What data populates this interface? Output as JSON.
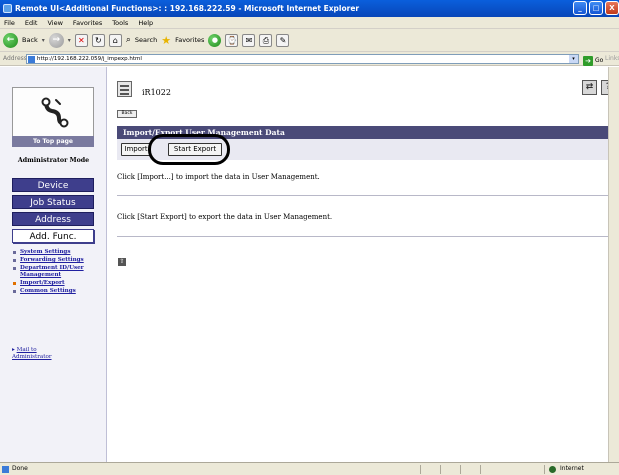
{
  "window": {
    "title": "Remote UI<Additional Functions>: : 192.168.222.59 - Microsoft Internet Explorer",
    "controls": [
      "_",
      "□",
      "X"
    ]
  },
  "menubar": [
    "File",
    "Edit",
    "View",
    "Favorites",
    "Tools",
    "Help"
  ],
  "toolbar": {
    "back_label": "Back",
    "search_label": "Search",
    "favorites_label": "Favorites"
  },
  "address": {
    "label": "Address",
    "url": "http://192.168.222.059/j_impexp.html",
    "go_label": "Go",
    "links_label": "Links"
  },
  "sidebar": {
    "to_top_label": "To Top page",
    "admin_mode_label": "Administrator Mode",
    "nav_buttons": [
      "Device",
      "Job Status",
      "Address",
      "Add. Func."
    ],
    "active_nav": "Add. Func.",
    "sublinks": [
      {
        "label": "System Settings"
      },
      {
        "label": "Forwarding Settings"
      },
      {
        "label": "Department ID/User Management"
      },
      {
        "label": "Import/Export"
      },
      {
        "label": "Common Settings"
      }
    ],
    "mail_link": [
      "Mail to",
      "Administrator"
    ]
  },
  "main": {
    "device_name": "iR1022",
    "back_label": "Back",
    "section_title": "Import/Export User Management Data",
    "import_button": "Import",
    "export_button": "Start Export",
    "instruction_import": "Click [Import...] to import the data in User Management.",
    "instruction_export": "Click [Start Export] to export the data in User Management."
  },
  "status": {
    "text": "Done",
    "zone": "Internet"
  }
}
